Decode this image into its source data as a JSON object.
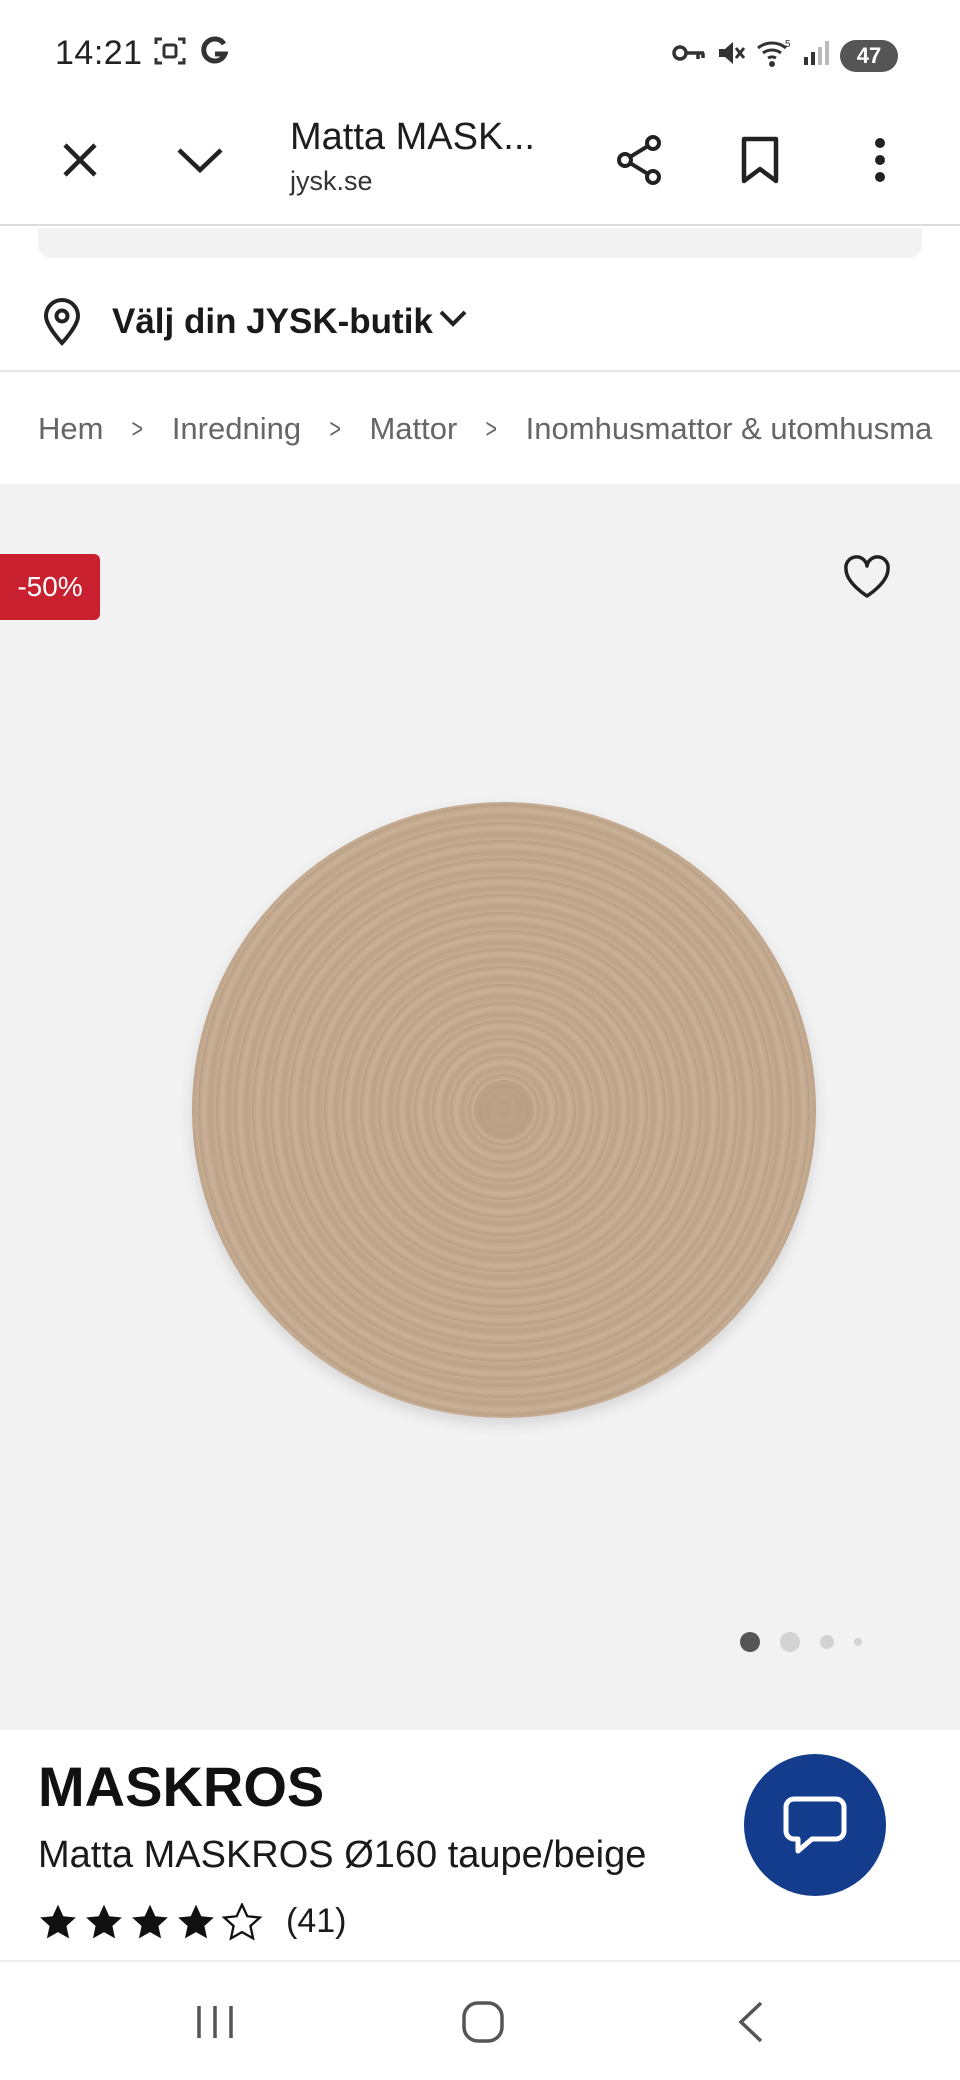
{
  "status_bar": {
    "time": "14:21",
    "battery": "47",
    "icons": [
      "screenshot-icon",
      "g-icon",
      "vpn-key-icon",
      "mute-icon",
      "wifi-icon",
      "signal-icon",
      "battery-icon"
    ]
  },
  "browser": {
    "title": "Matta MASK...",
    "url": "jysk.se",
    "icons": [
      "close-icon",
      "chevron-down-icon",
      "share-icon",
      "bookmark-icon",
      "more-vert-icon"
    ]
  },
  "store": {
    "label": "Välj din JYSK-butik"
  },
  "breadcrumb": {
    "items": [
      "Hem",
      "Inredning",
      "Mattor",
      "Inomhusmattor & utomhusma"
    ]
  },
  "gallery": {
    "discount": "-50%",
    "dot_count": 4,
    "active_dot": 0
  },
  "product": {
    "brand": "MASKROS",
    "name": "Matta MASKROS Ø160 taupe/beige",
    "rating_stars": 4,
    "rating_max": 5,
    "review_count": "(41)"
  },
  "colors": {
    "discount_bg": "#c8202f",
    "chat_bg": "#143c8c",
    "gallery_bg": "#f2f2f3"
  }
}
